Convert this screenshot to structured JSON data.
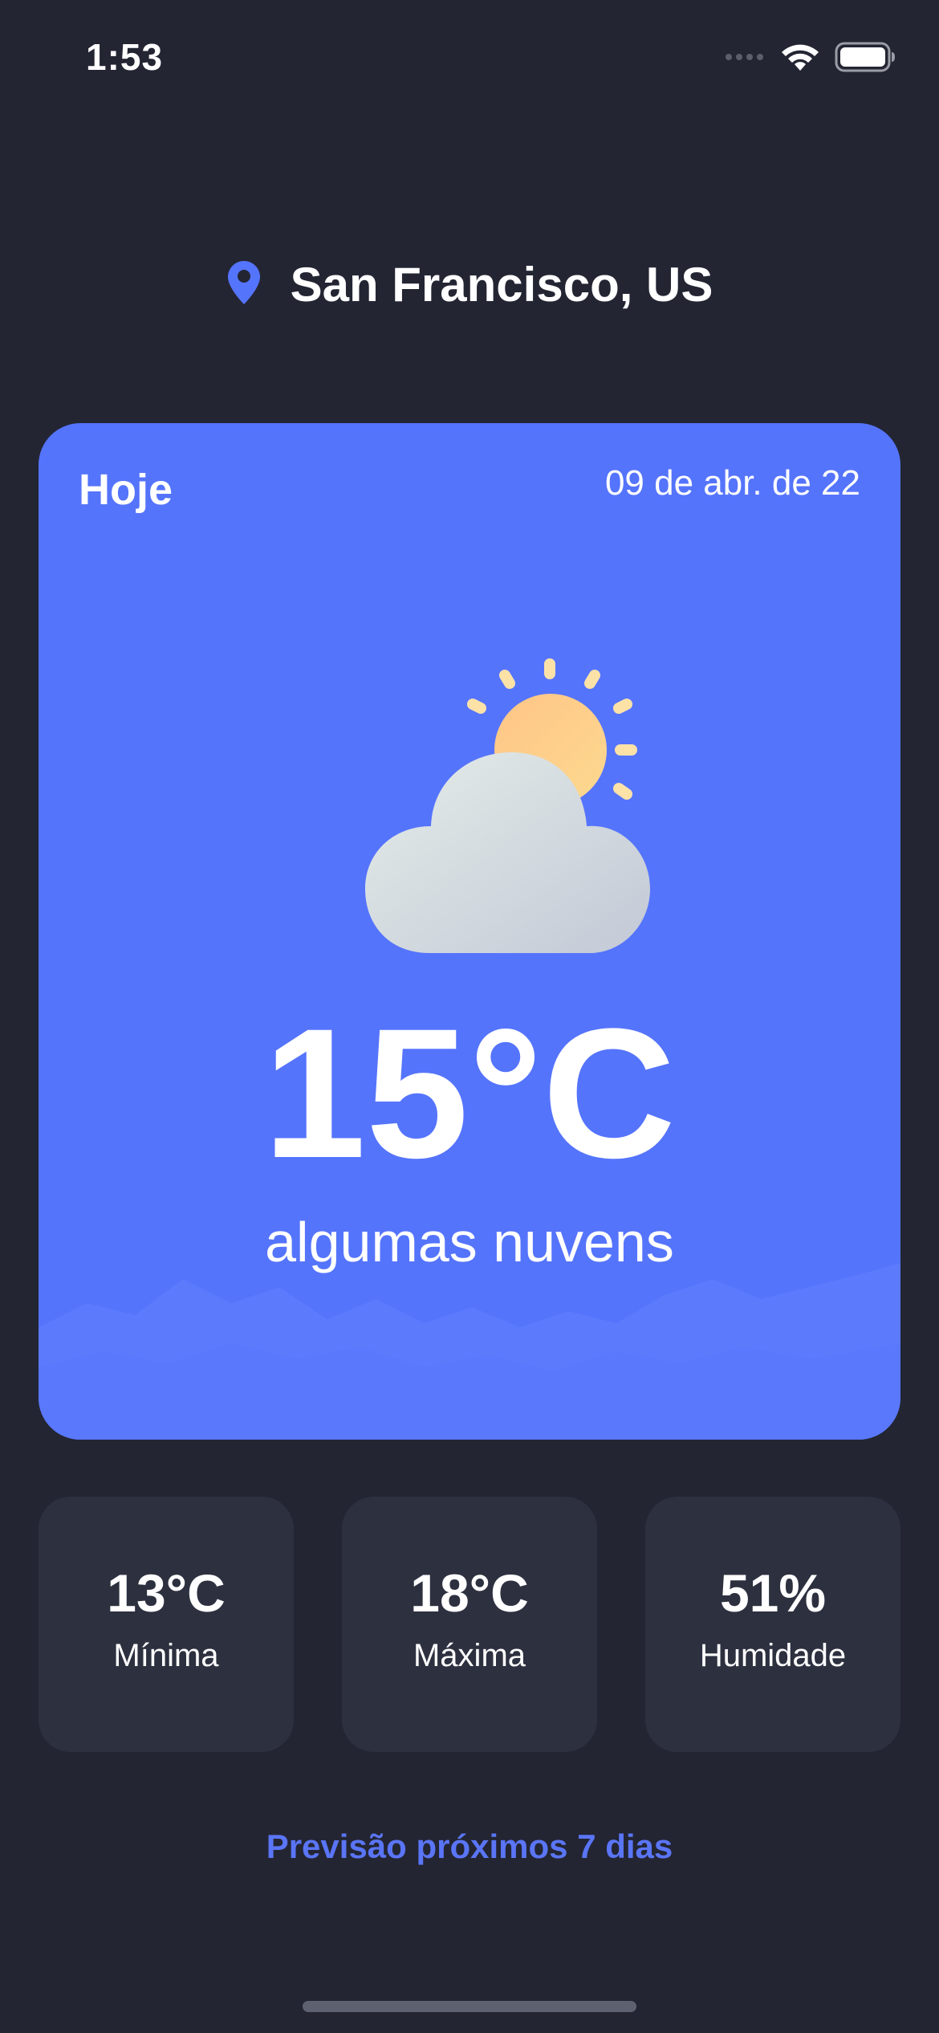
{
  "status_bar": {
    "time": "1:53",
    "signal_icon": "signal-dots-icon",
    "wifi_icon": "wifi-icon",
    "battery_icon": "battery-icon"
  },
  "location": {
    "icon": "location-pin-icon",
    "label": "San Francisco, US",
    "accent_color": "#5574fc"
  },
  "today_card": {
    "title": "Hoje",
    "date": "09 de abr. de 22",
    "icon": "partly-cloudy-icon",
    "temperature": "15°C",
    "description": "algumas nuvens",
    "background_color": "#5574fc"
  },
  "stats": [
    {
      "value": "13°C",
      "label": "Mínima"
    },
    {
      "value": "18°C",
      "label": "Máxima"
    },
    {
      "value": "51%",
      "label": "Humidade"
    }
  ],
  "forecast_link": {
    "label": "Previsão próximos 7 dias",
    "color": "#5a75f5"
  }
}
